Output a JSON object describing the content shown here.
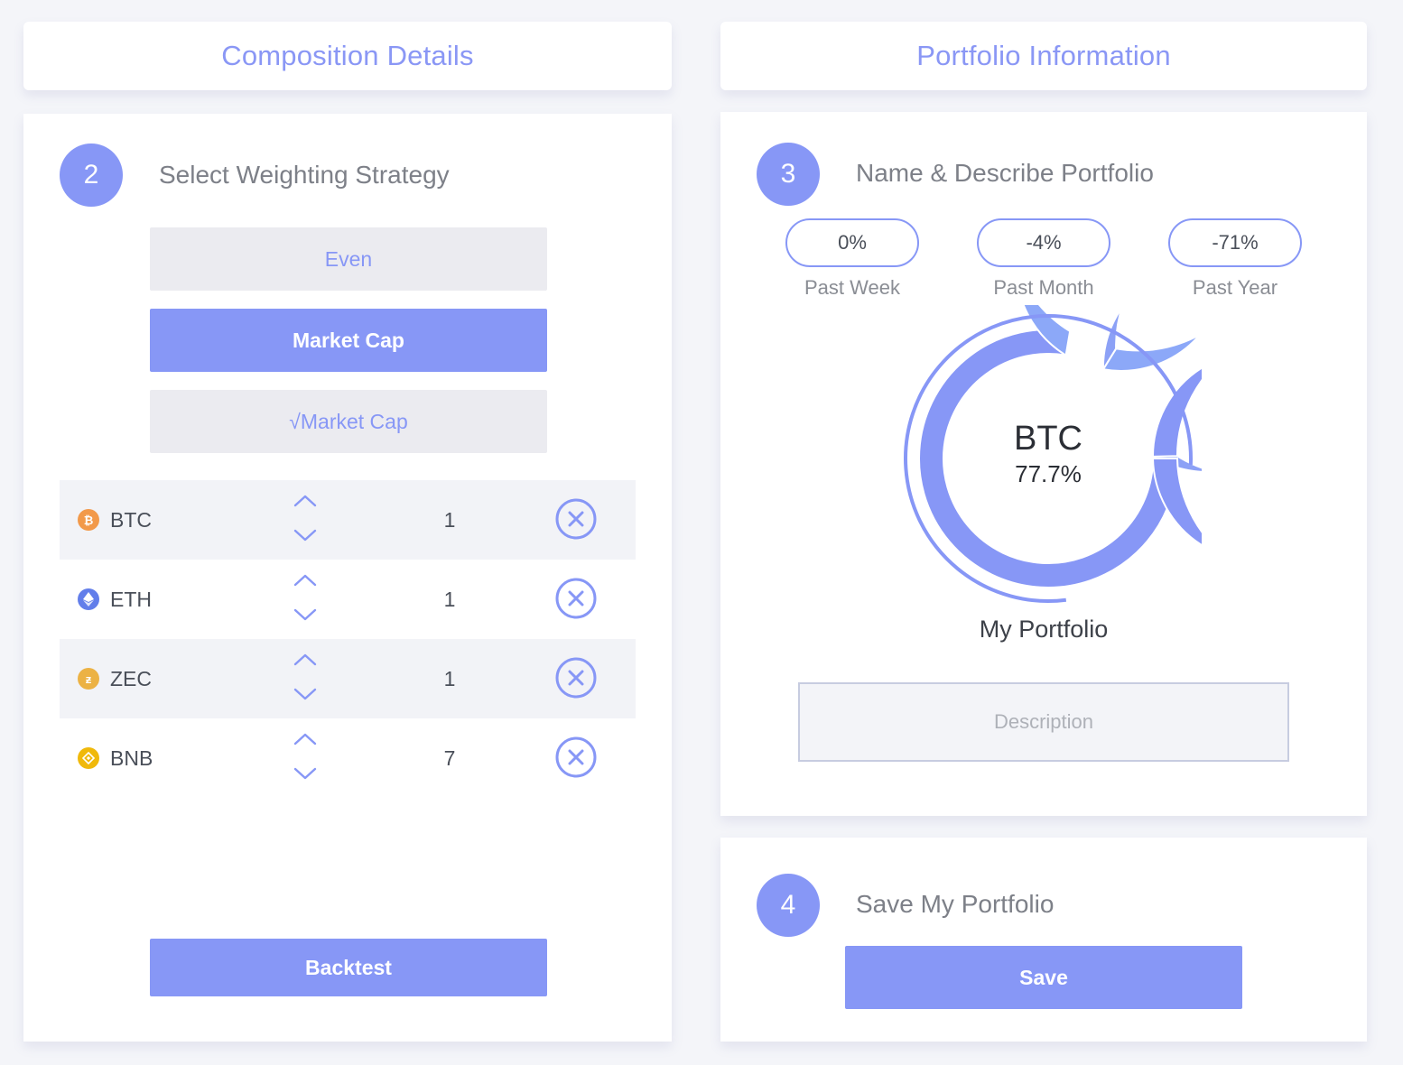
{
  "headers": {
    "composition": "Composition Details",
    "portfolio": "Portfolio Information"
  },
  "step2": {
    "number": "2",
    "title": "Select Weighting Strategy",
    "strategies": [
      {
        "label": "Even",
        "active": false
      },
      {
        "label": "Market Cap",
        "active": true
      },
      {
        "label": "√Market Cap",
        "active": false
      }
    ],
    "assets": [
      {
        "symbol": "BTC",
        "qty": "1",
        "icon": "bitcoin-icon",
        "color": "#f2994a"
      },
      {
        "symbol": "ETH",
        "qty": "1",
        "icon": "ethereum-icon",
        "color": "#627eea"
      },
      {
        "symbol": "ZEC",
        "qty": "1",
        "icon": "zcash-icon",
        "color": "#ecb244"
      },
      {
        "symbol": "BNB",
        "qty": "7",
        "icon": "binance-icon",
        "color": "#f0b90b"
      }
    ],
    "backtest_label": "Backtest"
  },
  "step3": {
    "number": "3",
    "title": "Name & Describe Portfolio",
    "performance": [
      {
        "value": "0%",
        "label": "Past Week"
      },
      {
        "value": "-4%",
        "label": "Past Month"
      },
      {
        "value": "-71%",
        "label": "Past Year"
      }
    ],
    "donut": {
      "center_symbol": "BTC",
      "center_percent": "77.7%",
      "segments": [
        {
          "name": "BTC",
          "percent": 77.7,
          "color": "#8797f6"
        },
        {
          "name": "ETH",
          "percent": 6.1,
          "color": "#8ca8f8"
        },
        {
          "name": "ZEC",
          "percent": 15.9,
          "color": "#8ca1f6"
        },
        {
          "name": "BNB",
          "percent": 0.3,
          "color": "#8797f6"
        }
      ],
      "highlight_percent": 77.7
    },
    "portfolio_name": "My Portfolio",
    "description_placeholder": "Description"
  },
  "step4": {
    "number": "4",
    "title": "Save My Portfolio",
    "save_label": "Save"
  },
  "colors": {
    "accent": "#8797f6",
    "background": "#f4f5f9",
    "inactive_button": "#ebebf0"
  }
}
